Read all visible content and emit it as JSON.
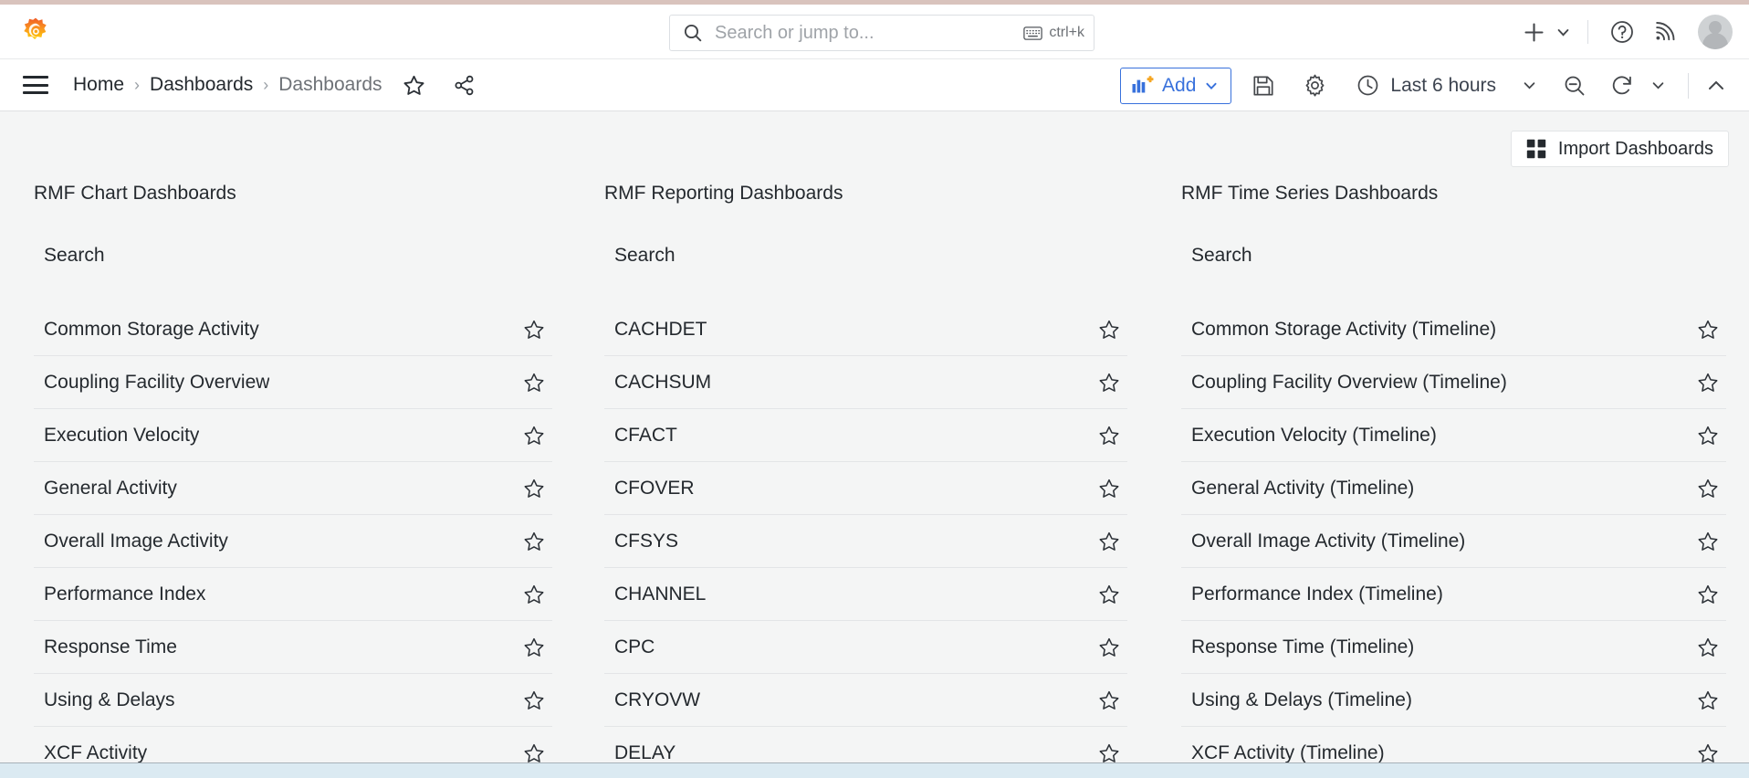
{
  "brand": {
    "logo_icon": "grafana-logo-icon"
  },
  "search": {
    "icon": "search-icon",
    "placeholder": "Search or jump to...",
    "value": "",
    "shortcut_icon": "keyboard-icon",
    "shortcut_label": "ctrl+k"
  },
  "topbar_right": {
    "add_icon": "plus-icon",
    "add_caret_icon": "chevron-down-icon",
    "help_icon": "help-circle-icon",
    "news_icon": "rss-icon",
    "avatar_icon": "user-avatar"
  },
  "nav": {
    "menu_icon": "hamburger-menu-icon",
    "breadcrumb": [
      {
        "label": "Home",
        "current": false
      },
      {
        "label": "Dashboards",
        "current": false
      },
      {
        "label": "Dashboards",
        "current": true
      }
    ],
    "separator": "›",
    "star_icon": "star-outline-icon",
    "share_icon": "share-nodes-icon"
  },
  "toolbar": {
    "add_label": "Add",
    "add_icon": "add-panel-icon",
    "add_caret_icon": "chevron-down-icon",
    "save_icon": "save-disk-icon",
    "settings_icon": "gear-icon",
    "time_icon": "clock-icon",
    "time_range": "Last 6 hours",
    "time_caret_icon": "chevron-down-icon",
    "zoom_out_icon": "zoom-out-icon",
    "refresh_icon": "refresh-icon",
    "refresh_caret_icon": "chevron-down-icon",
    "collapse_icon": "chevron-up-icon",
    "accent_color": "#3871dc"
  },
  "main": {
    "import_button": {
      "label": "Import Dashboards",
      "icon": "apps-grid-icon"
    },
    "panels": [
      {
        "title": "RMF Chart Dashboards",
        "search_label": "Search",
        "star_icon": "star-outline-icon",
        "items": [
          "Common Storage Activity",
          "Coupling Facility Overview",
          "Execution Velocity",
          "General Activity",
          "Overall Image Activity",
          "Performance Index",
          "Response Time",
          "Using & Delays",
          "XCF Activity"
        ]
      },
      {
        "title": "RMF Reporting Dashboards",
        "search_label": "Search",
        "star_icon": "star-outline-icon",
        "items": [
          "CACHDET",
          "CACHSUM",
          "CFACT",
          "CFOVER",
          "CFSYS",
          "CHANNEL",
          "CPC",
          "CRYOVW",
          "DELAY"
        ]
      },
      {
        "title": "RMF Time Series Dashboards",
        "search_label": "Search",
        "star_icon": "star-outline-icon",
        "items": [
          "Common Storage Activity (Timeline)",
          "Coupling Facility Overview (Timeline)",
          "Execution Velocity (Timeline)",
          "General Activity (Timeline)",
          "Overall Image Activity (Timeline)",
          "Performance Index (Timeline)",
          "Response Time (Timeline)",
          "Using & Delays (Timeline)",
          "XCF Activity (Timeline)"
        ]
      }
    ]
  },
  "scrollbar": {
    "orientation": "horizontal"
  },
  "colors": {
    "accent_blue": "#3871dc",
    "page_bg": "#f4f5f5",
    "panel_bg": "#ffffff",
    "text": "#24292e",
    "muted_text": "#6e7277",
    "divider": "#e3e5e7",
    "top_strip": "#d9c3bd"
  }
}
